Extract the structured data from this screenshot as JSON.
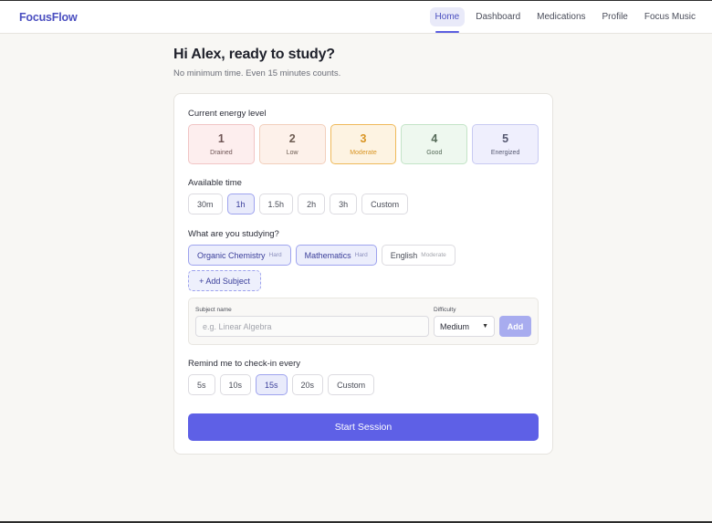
{
  "app": {
    "logo": "FocusFlow"
  },
  "nav": {
    "items": [
      {
        "label": "Home",
        "active": true
      },
      {
        "label": "Dashboard",
        "active": false
      },
      {
        "label": "Medications",
        "active": false
      },
      {
        "label": "Profile",
        "active": false
      },
      {
        "label": "Focus Music",
        "active": false
      }
    ]
  },
  "header": {
    "greeting": "Hi Alex, ready to study?",
    "subtitle": "No minimum time. Even 15 minutes counts."
  },
  "energy": {
    "label": "Current energy level",
    "options": [
      {
        "num": "1",
        "label": "Drained"
      },
      {
        "num": "2",
        "label": "Low"
      },
      {
        "num": "3",
        "label": "Moderate"
      },
      {
        "num": "4",
        "label": "Good"
      },
      {
        "num": "5",
        "label": "Energized"
      }
    ],
    "selected": "3"
  },
  "time": {
    "label": "Available time",
    "options": [
      "30m",
      "1h",
      "1.5h",
      "2h",
      "3h",
      "Custom"
    ],
    "selected": "1h"
  },
  "subjects": {
    "label": "What are you studying?",
    "items": [
      {
        "name": "Organic Chemistry",
        "difficulty": "Hard",
        "selected": true
      },
      {
        "name": "Mathematics",
        "difficulty": "Hard",
        "selected": true
      },
      {
        "name": "English",
        "difficulty": "Moderate",
        "selected": false
      }
    ],
    "add_label": "+ Add Subject",
    "form": {
      "name_label": "Subject name",
      "name_placeholder": "e.g. Linear Algebra",
      "difficulty_label": "Difficulty",
      "difficulty_value": "Medium",
      "add_button": "Add"
    }
  },
  "reminder": {
    "label": "Remind me to check-in every",
    "options": [
      "5s",
      "10s",
      "15s",
      "20s",
      "Custom"
    ],
    "selected": "15s"
  },
  "actions": {
    "start": "Start Session"
  },
  "colors": {
    "accent": "#5e60e6",
    "brand": "#4b4fc0"
  }
}
